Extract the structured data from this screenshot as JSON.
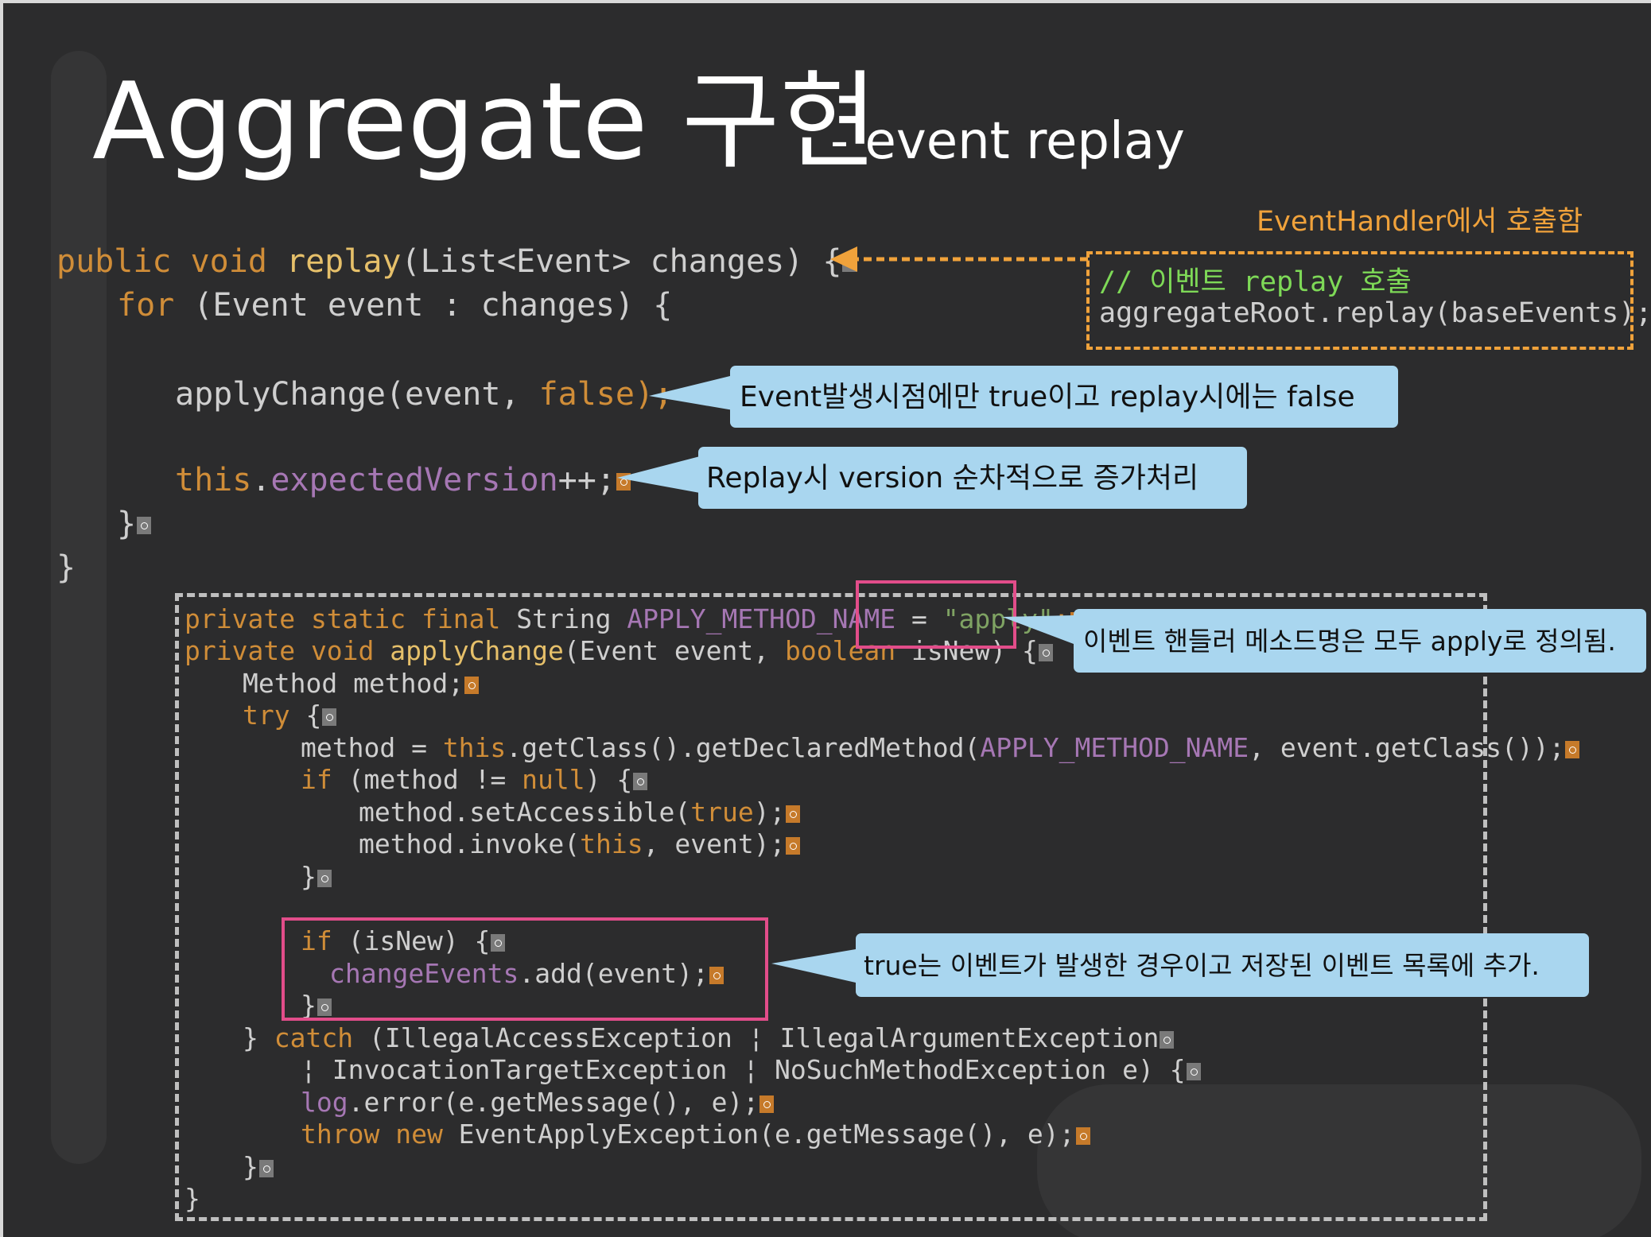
{
  "title": {
    "main": "Aggregate 구현",
    "sub": "- event replay"
  },
  "colors": {
    "background": "#2c2c2d",
    "keyword": "#d08d38",
    "method": "#e6c06a",
    "field": "#a677b4",
    "string": "#7fa363",
    "callout": "#a9d6ef",
    "highlight_pink": "#e24d8a",
    "orange": "#f0a23b",
    "comment_green": "#7ed957"
  },
  "replay_code": {
    "l1_public": "public",
    "l1_void": "void",
    "l1_replay": "replay",
    "l1_rest": "(List<Event> changes) {",
    "l2_for": "for",
    "l2_rest": " (Event event : changes) {",
    "l3_apply": "applyChange(event, ",
    "l3_false": "false",
    "l3_end": ");",
    "l4_this": "this",
    "l4_dot": ".",
    "l4_field": "expectedVersion",
    "l4_end": "++;",
    "l5": "}",
    "l6": "}"
  },
  "apply_code": {
    "l1_kw": "private static final",
    "l1_type": " String ",
    "l1_const": "APPLY_METHOD_NAME",
    "l1_eq": " = ",
    "l1_str": "\"apply\"",
    "l1_end": ";",
    "l2_kw": "private void",
    "l2_fn": "applyChange",
    "l2_a": "(Event event, ",
    "l2_bool": "boolean",
    "l2_b": " isNew) {",
    "l3": "Method method;",
    "l4_try": "try",
    "l4_b": " {",
    "l5_a": "method = ",
    "l5_this": "this",
    "l5_b": ".getClass().getDeclaredMethod(",
    "l5_const": "APPLY_METHOD_NAME",
    "l5_c": ", event.getClass());",
    "l6_if": "if",
    "l6_a": " (method != ",
    "l6_null": "null",
    "l6_b": ") {",
    "l7_a": "method.setAccessible(",
    "l7_true": "true",
    "l7_b": ");",
    "l8_a": "method.invoke(",
    "l8_this": "this",
    "l8_b": ", event);",
    "l9": "}",
    "l10_if": "if",
    "l10_a": " (isNew) {",
    "l11_field": "changeEvents",
    "l11_a": ".add(event);",
    "l12": "}",
    "l13_a": "} ",
    "l13_catch": "catch",
    "l13_b": " (IllegalAccessException ¦ IllegalArgumentException",
    "l14": "¦ InvocationTargetException ¦ NoSuchMethodException e) {",
    "l15_log": "log",
    "l15_a": ".error(e.getMessage(), e);",
    "l16_throw": "throw new",
    "l16_a": " EventApplyException(e.getMessage(), e);",
    "l17": "}",
    "l18": "}"
  },
  "annotations": {
    "orange_label": "EventHandler에서 호출함",
    "orange_comment": "// 이벤트 replay 호출",
    "orange_call": "aggregateRoot.replay(baseEvents);",
    "callout_apply_change": "Event발생시점에만 true이고 replay시에는 false",
    "callout_version": "Replay시 version 순차적으로 증가처리",
    "callout_method_name": "이벤트 핸들러 메소드명은 모두 apply로 정의됨.",
    "callout_is_new": "true는 이벤트가 발생한 경우이고 저장된 이벤트 목록에 추가."
  }
}
